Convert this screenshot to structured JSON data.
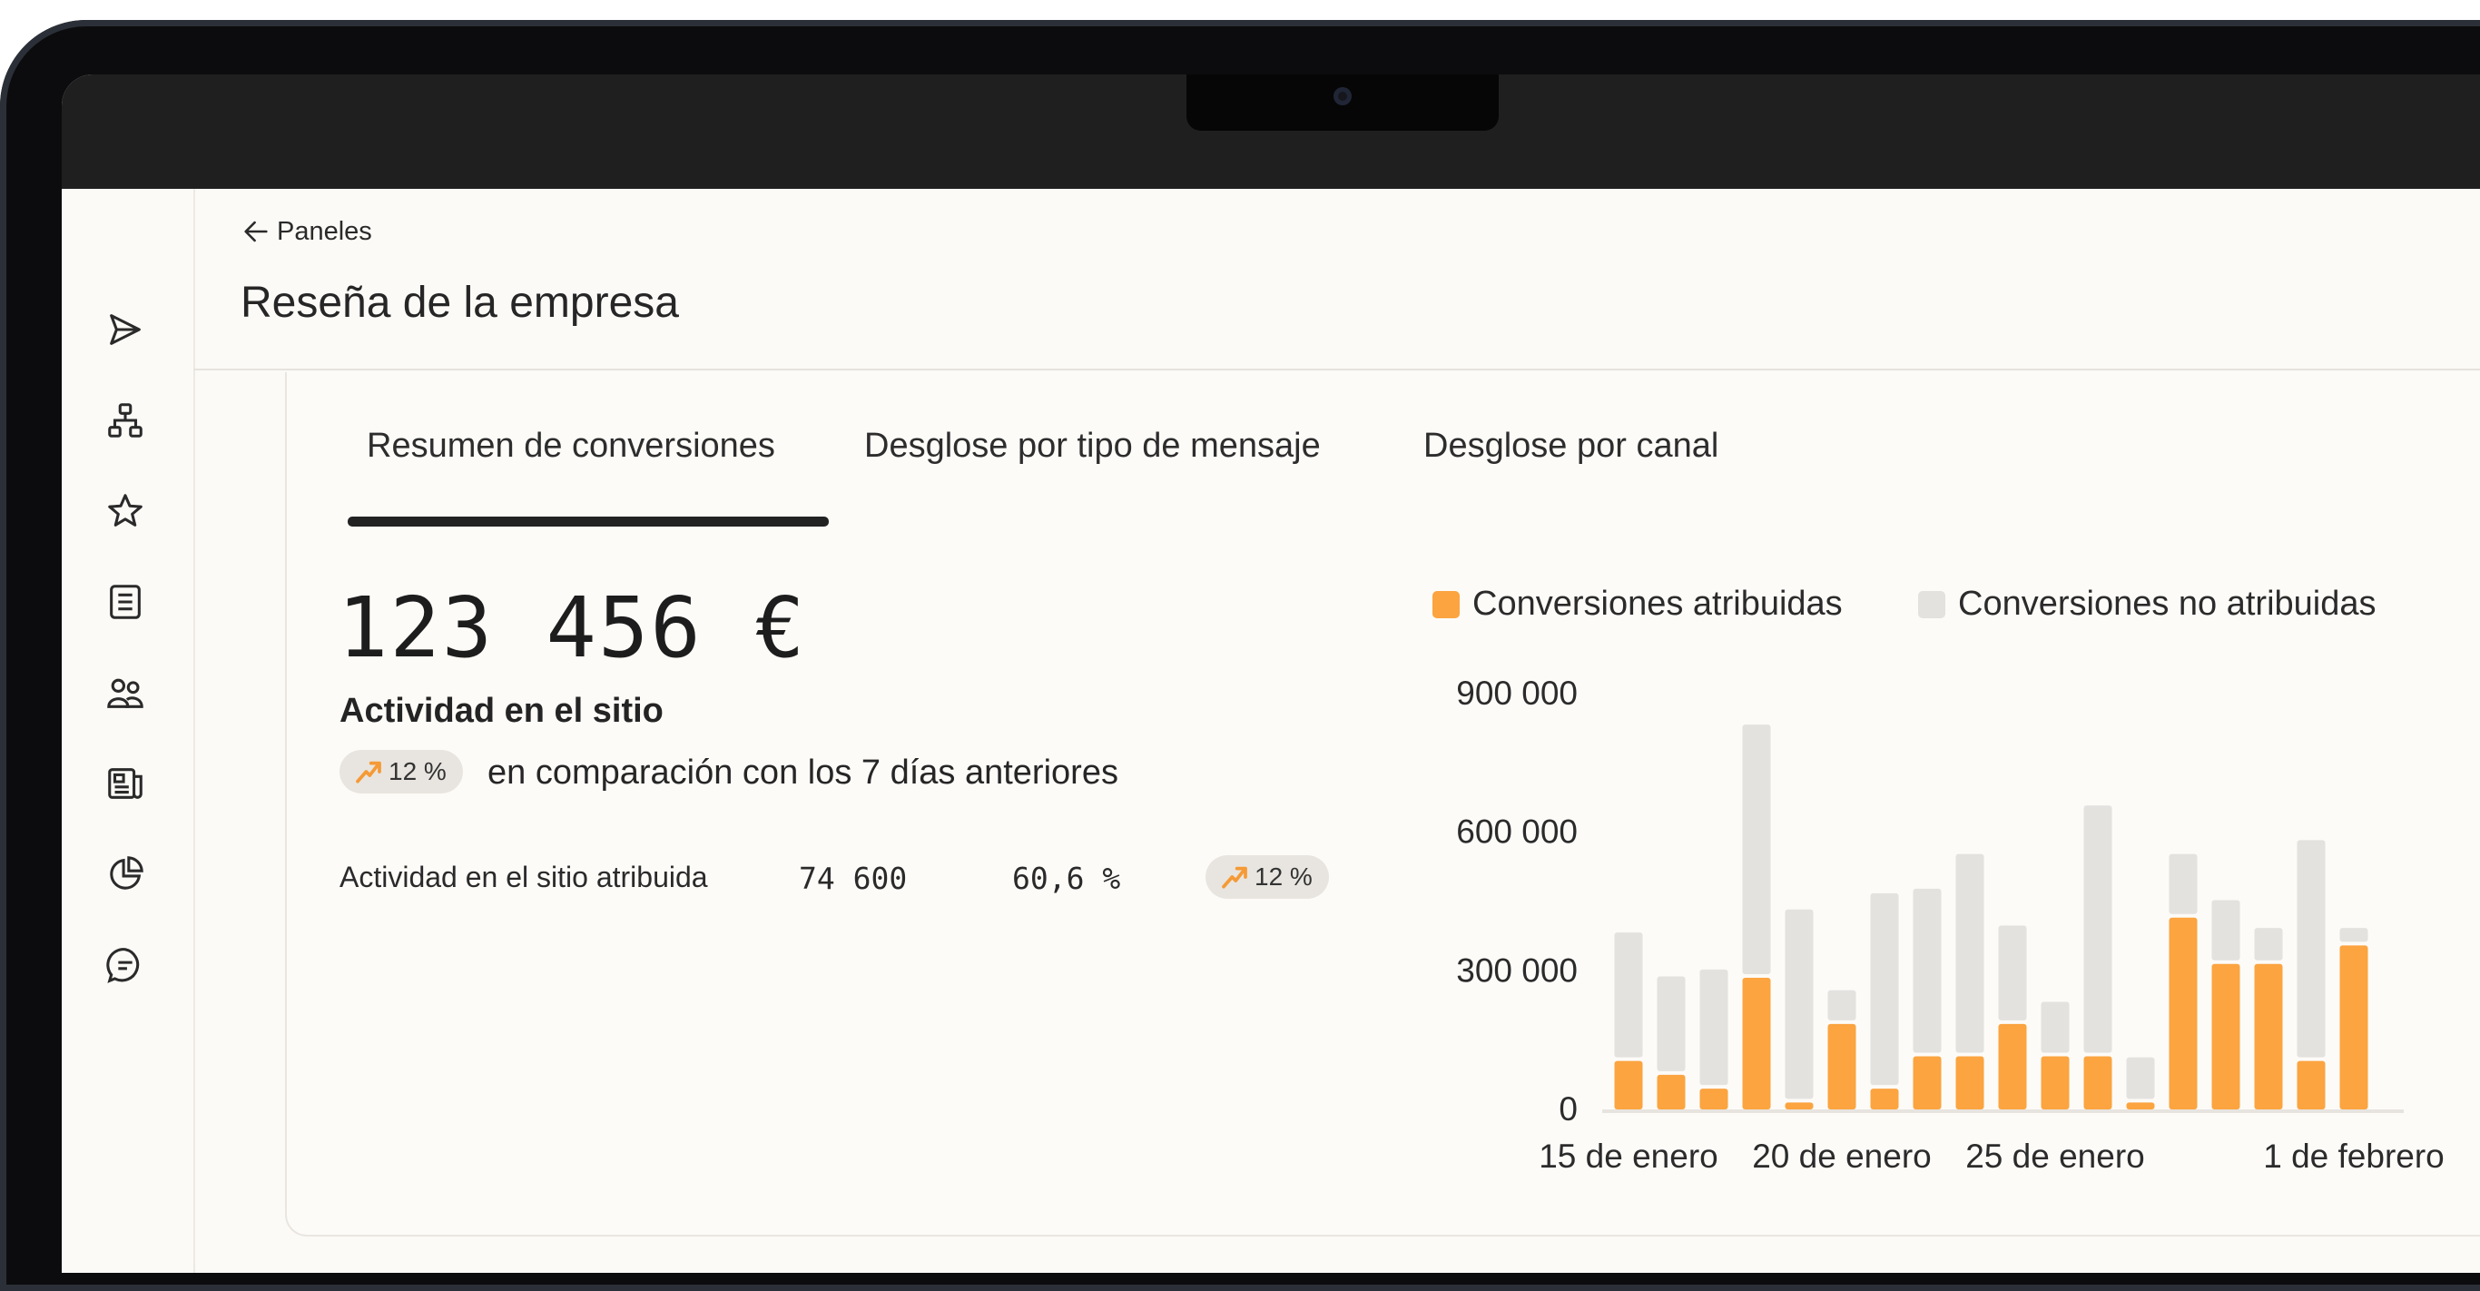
{
  "header": {
    "back_label": "Paneles",
    "title": "Reseña de la empresa"
  },
  "sidebar": {
    "icons": [
      "send-icon",
      "hierarchy-icon",
      "star-icon",
      "list-icon",
      "users-icon",
      "newspaper-icon",
      "pie-chart-icon",
      "chat-icon"
    ]
  },
  "tabs": [
    {
      "label": "Resumen de conversiones",
      "active": true
    },
    {
      "label": "Desglose por tipo de mensaje",
      "active": false
    },
    {
      "label": "Desglose por canal",
      "active": false
    }
  ],
  "metric": {
    "value": "123 456 €",
    "label": "Actividad en el sitio",
    "change": "12 %",
    "change_direction": "up",
    "comparison": "en comparación con los 7 días anteriores"
  },
  "attributed_row": {
    "label": "Actividad en el sitio atribuida",
    "count": "74 600",
    "percent": "60,6 %",
    "change": "12 %",
    "change_direction": "up"
  },
  "colors": {
    "attributed": "#fba440",
    "unattributed": "#e4e2df",
    "trend_arrow": "#f59a36"
  },
  "chart_data": {
    "type": "bar",
    "stacked": true,
    "legend_position": "top",
    "y_ticks": [
      "900 000",
      "600 000",
      "300 000",
      "0"
    ],
    "ylim": [
      0,
      900000
    ],
    "x_tick_labels": [
      "15 de enero",
      "20 de enero",
      "25 de enero",
      "1 de febrero"
    ],
    "x_tick_positions": [
      0,
      5,
      10,
      17
    ],
    "x": [
      "15 de enero",
      "16 de enero",
      "17 de enero",
      "18 de enero",
      "19 de enero",
      "20 de enero",
      "21 de enero",
      "22 de enero",
      "23 de enero",
      "24 de enero",
      "25 de enero",
      "26 de enero",
      "27 de enero",
      "28 de enero",
      "29 de enero",
      "30 de enero",
      "31 de enero",
      "1 de febrero",
      "2 de febrero"
    ],
    "series": [
      {
        "name": "Conversiones atribuidas",
        "values": [
          105000,
          75000,
          45000,
          285000,
          15000,
          185000,
          45000,
          115000,
          115000,
          185000,
          115000,
          115000,
          15000,
          415000,
          315000,
          315000,
          105000,
          355000,
          0
        ]
      },
      {
        "name": "Conversiones no atribuidas",
        "values": [
          270000,
          205000,
          250000,
          540000,
          410000,
          65000,
          415000,
          355000,
          430000,
          205000,
          110000,
          535000,
          90000,
          130000,
          130000,
          70000,
          470000,
          30000,
          0
        ]
      }
    ]
  }
}
